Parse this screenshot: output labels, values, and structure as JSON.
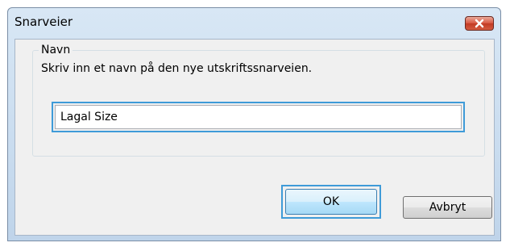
{
  "window": {
    "title": "Snarveier"
  },
  "group": {
    "legend": "Navn",
    "description": "Skriv inn et navn på den nye utskriftssnarveien."
  },
  "name_field": {
    "value": "Lagal Size"
  },
  "buttons": {
    "ok_label": "OK",
    "cancel_label": "Avbryt"
  },
  "icons": {
    "close": "close-icon"
  },
  "colors": {
    "focus_border": "#3f9bd8",
    "close_button": "#c23a24"
  }
}
